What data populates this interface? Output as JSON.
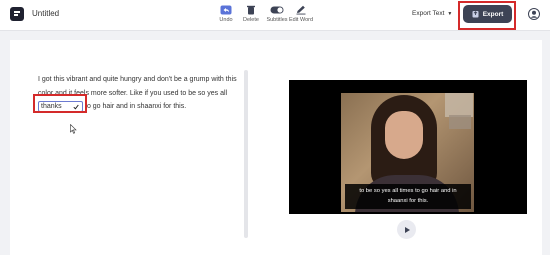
{
  "app": {
    "doc_title": "Untitled"
  },
  "toolbar": {
    "undo_label": "Undo",
    "delete_label": "Delete",
    "subtitles_label": "Subtitles",
    "edit_word_label": "Edit Word",
    "export_text_label": "Export Text",
    "export_button_label": "Export"
  },
  "transcript": {
    "line_before": "I got this vibrant and quite hungry and don't be a grump with this color and it feels more softer. Like if you used to be so yes all",
    "edit_value": "thanks",
    "line_after": "to go hair and in shaanxi for this."
  },
  "video": {
    "subtitle_line1": "to be so yes all times to go hair and in",
    "subtitle_line2": "shaanxi for this."
  },
  "colors": {
    "export_button": "#3d4355",
    "highlight": "#d42a2a",
    "edit_border": "#6b7ad1"
  },
  "icons": {
    "undo": "undo-icon",
    "delete": "trash-icon",
    "subtitles": "toggle-icon",
    "edit_word": "pencil-icon",
    "export": "export-icon",
    "user": "user-icon",
    "play": "play-icon",
    "check": "check-icon"
  }
}
